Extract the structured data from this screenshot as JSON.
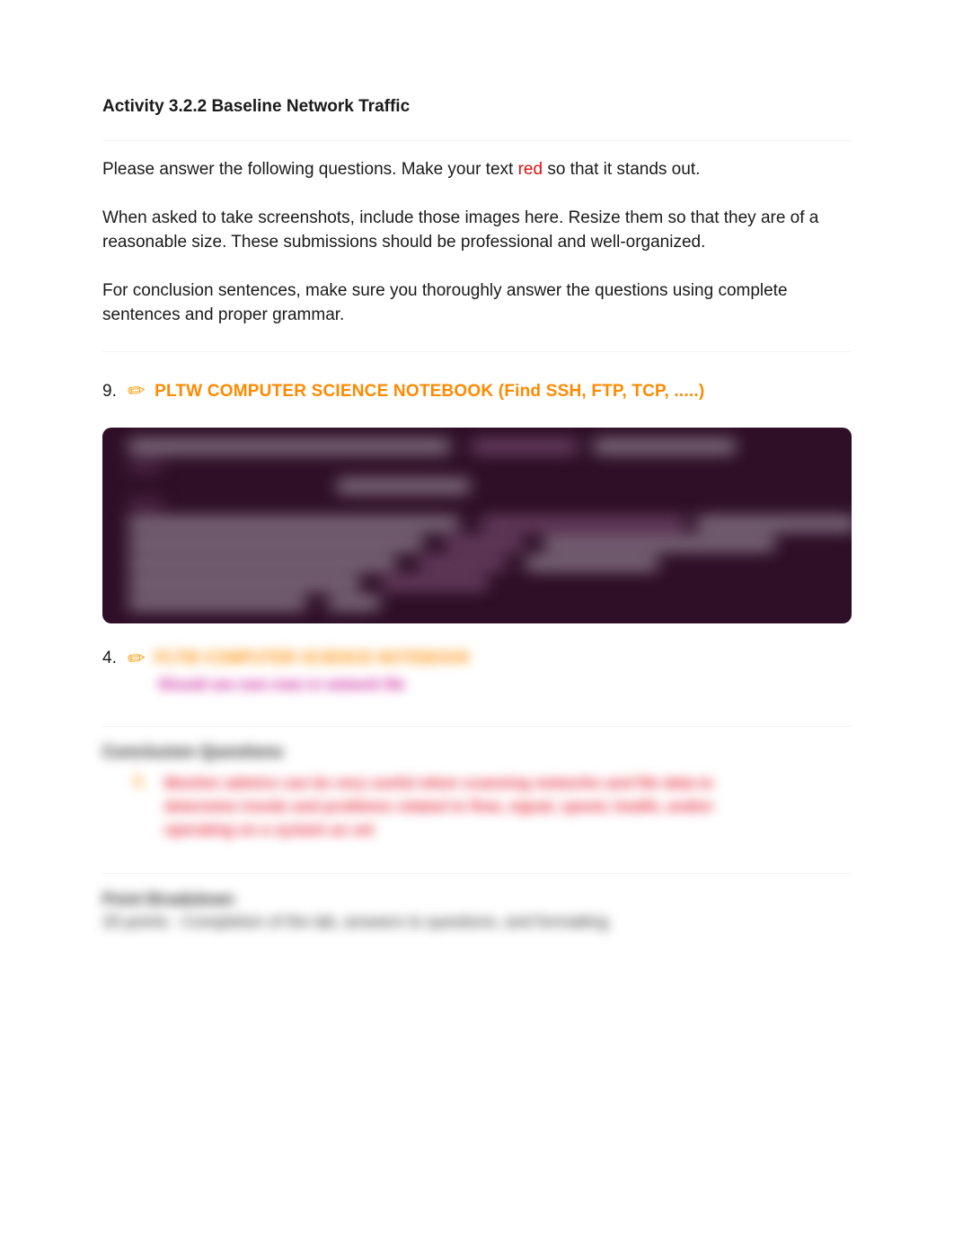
{
  "title": "Activity 3.2.2 Baseline Network Traffic",
  "para1_a": "Please answer the following questions. Make your text ",
  "para1_red": "red",
  "para1_b": " so that it stands out.",
  "para2": "When asked to take screenshots, include those images here. Resize them so that they are of a reasonable size. These submissions should be professional and well-organized.",
  "para3": "For conclusion sentences, make sure you thoroughly answer the questions using complete sentences and proper grammar.",
  "section9": {
    "number": "9.",
    "heading": "PLTW COMPUTER SCIENCE NOTEBOOK (Find SSH, FTP, TCP, .....)"
  },
  "section4": {
    "number": "4.",
    "heading_blurred": "PLTW COMPUTER SCIENCE NOTEBOOK",
    "sub_blurred": "Should see new rows in network file"
  },
  "conclusion": {
    "heading_blurred": "Conclusion Questions",
    "item_number_blurred": "1.",
    "item_body_blurred": "Monitor admins can be very useful when scanning networks and file data to determine trends and problems related to flow, signal, speed, health, and/or operating on a system as set"
  },
  "breakdown": {
    "heading_blurred": "Point Breakdown",
    "body_blurred": "20 points - Completion of the lab, answers to questions, and formatting"
  },
  "icons": {
    "pencil": "✏"
  }
}
